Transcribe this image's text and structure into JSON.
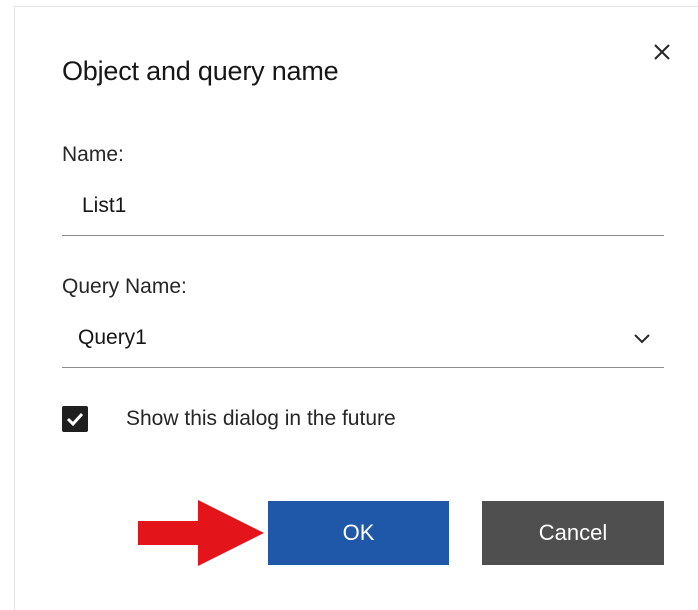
{
  "dialog": {
    "title": "Object and query name",
    "close_icon": "close-icon"
  },
  "name_field": {
    "label": "Name:",
    "value": "List1"
  },
  "query_field": {
    "label": "Query Name:",
    "selected": "Query1",
    "dropdown_icon": "chevron-down-icon"
  },
  "checkbox": {
    "checked": true,
    "label": "Show this dialog in the future"
  },
  "buttons": {
    "ok": "OK",
    "cancel": "Cancel"
  },
  "annotation": {
    "icon": "red-arrow-icon",
    "color": "#e3151b"
  },
  "colors": {
    "ok_button": "#1f58a8",
    "cancel_button": "#4f4f4f",
    "checkbox": "#1f1f1f"
  }
}
